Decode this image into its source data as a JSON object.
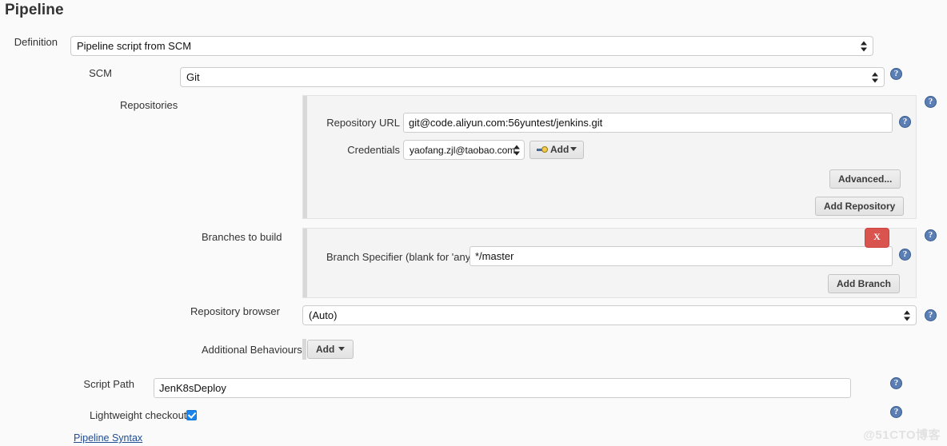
{
  "page": {
    "title": "Pipeline",
    "watermark": "@51CTO博客",
    "help_glyph": "?",
    "delete_glyph": "X"
  },
  "definition": {
    "label": "Definition",
    "value": "Pipeline script from SCM"
  },
  "scm": {
    "label": "SCM",
    "value": "Git",
    "help": "?"
  },
  "repositories": {
    "label": "Repositories",
    "help_outer": "?",
    "repository_url": {
      "label": "Repository URL",
      "value": "git@code.aliyun.com:56yuntest/jenkins.git",
      "help": "?"
    },
    "credentials": {
      "label": "Credentials",
      "value": "yaofang.zjl@taobao.com",
      "add_label": "Add",
      "add_icon": "key-icon"
    },
    "advanced_label": "Advanced...",
    "add_repository_label": "Add Repository"
  },
  "branches": {
    "label": "Branches to build",
    "help_outer": "?",
    "branch_specifier": {
      "label": "Branch Specifier (blank for 'any')",
      "value": "*/master",
      "help": "?"
    },
    "delete_label": "X",
    "add_branch_label": "Add Branch"
  },
  "repository_browser": {
    "label": "Repository browser",
    "value": "(Auto)",
    "help": "?"
  },
  "additional_behaviours": {
    "label": "Additional Behaviours",
    "add_label": "Add"
  },
  "script_path": {
    "label": "Script Path",
    "value": "JenK8sDeploy",
    "help": "?"
  },
  "lightweight_checkout": {
    "label": "Lightweight checkout",
    "checked": true,
    "help": "?"
  },
  "pipeline_syntax": {
    "label": "Pipeline Syntax"
  }
}
